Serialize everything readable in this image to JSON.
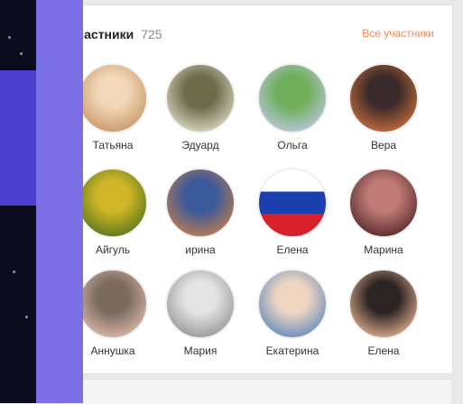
{
  "members_widget": {
    "title": "частники",
    "count": "725",
    "all_link": "Все участники"
  },
  "members": [
    {
      "name": "Татьяна",
      "colors": [
        "#f2d7b8",
        "#c99a6a"
      ]
    },
    {
      "name": "Эдуард",
      "colors": [
        "#6b6b4a",
        "#d7d2bd"
      ]
    },
    {
      "name": "Ольга",
      "colors": [
        "#6fae5a",
        "#b6c6d8"
      ]
    },
    {
      "name": "Вера",
      "colors": [
        "#3a2a2a",
        "#c06a3a"
      ]
    },
    {
      "name": "Айгуль",
      "colors": [
        "#d0b626",
        "#5d7a1e"
      ]
    },
    {
      "name": "ирина",
      "colors": [
        "#3a5a9a",
        "#b87a54"
      ]
    },
    {
      "name": "Елена",
      "colors": [
        "#ffffff",
        "#1c3fb0",
        "#d8202a"
      ]
    },
    {
      "name": "Марина",
      "colors": [
        "#c07b76",
        "#5a2d2d"
      ]
    },
    {
      "name": "Аннушка",
      "colors": [
        "#7a6a60",
        "#d7b6a4"
      ]
    },
    {
      "name": "Мария",
      "colors": [
        "#e4e4e4",
        "#9a9a9a"
      ]
    },
    {
      "name": "Екатерина",
      "colors": [
        "#f0d6c0",
        "#6a8fbf"
      ]
    },
    {
      "name": "Елена",
      "colors": [
        "#2c2424",
        "#d7a888"
      ]
    }
  ]
}
